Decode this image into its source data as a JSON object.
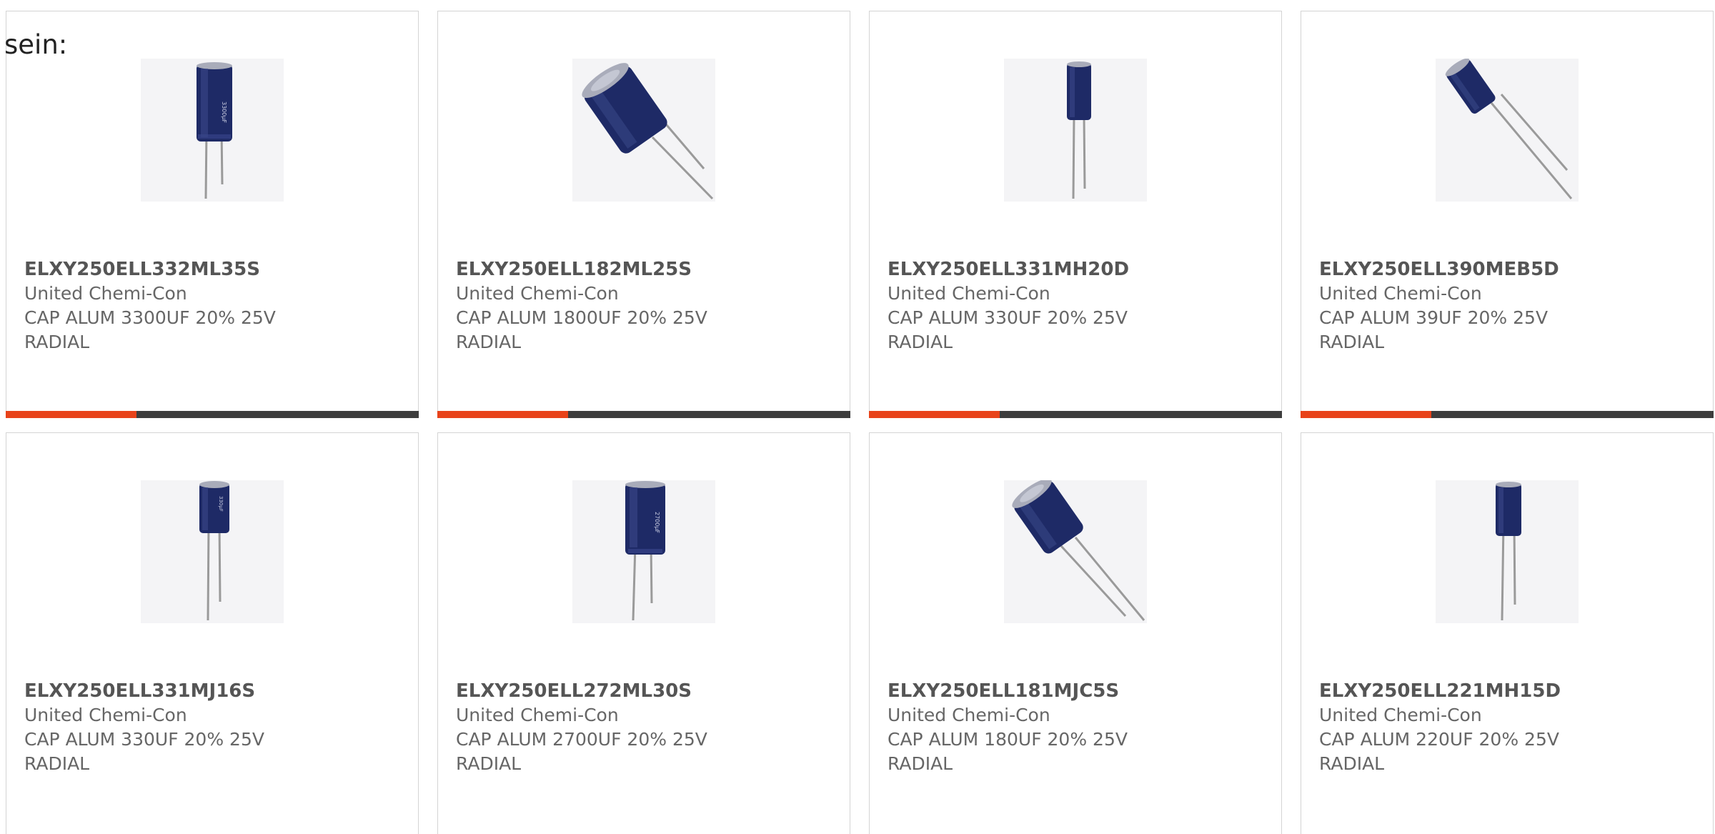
{
  "intro_text": "sein:",
  "colors": {
    "accent": "#e8431a",
    "bar": "#3d3d3d",
    "border": "#d4d4d4",
    "capacitor_body": "#1e2a66",
    "capacitor_top": "#a9acba",
    "lead": "#9a9a9a"
  },
  "products": [
    {
      "part_number": "ELXY250ELL332ML35S",
      "manufacturer": "United Chemi-Con",
      "desc_line1": "CAP ALUM 3300UF 20% 25V",
      "desc_line2": "RADIAL",
      "image": "capacitor-upright"
    },
    {
      "part_number": "ELXY250ELL182ML25S",
      "manufacturer": "United Chemi-Con",
      "desc_line1": "CAP ALUM 1800UF 20% 25V",
      "desc_line2": "RADIAL",
      "image": "capacitor-tilted"
    },
    {
      "part_number": "ELXY250ELL331MH20D",
      "manufacturer": "United Chemi-Con",
      "desc_line1": "CAP ALUM 330UF 20% 25V",
      "desc_line2": "RADIAL",
      "image": "capacitor-upright"
    },
    {
      "part_number": "ELXY250ELL390MEB5D",
      "manufacturer": "United Chemi-Con",
      "desc_line1": "CAP ALUM 39UF 20% 25V",
      "desc_line2": "RADIAL",
      "image": "capacitor-tilted"
    },
    {
      "part_number": "ELXY250ELL331MJ16S",
      "manufacturer": "United Chemi-Con",
      "desc_line1": "CAP ALUM 330UF 20% 25V",
      "desc_line2": "RADIAL",
      "image": "capacitor-upright"
    },
    {
      "part_number": "ELXY250ELL272ML30S",
      "manufacturer": "United Chemi-Con",
      "desc_line1": "CAP ALUM 2700UF 20% 25V",
      "desc_line2": "RADIAL",
      "image": "capacitor-upright"
    },
    {
      "part_number": "ELXY250ELL181MJC5S",
      "manufacturer": "United Chemi-Con",
      "desc_line1": "CAP ALUM 180UF 20% 25V",
      "desc_line2": "RADIAL",
      "image": "capacitor-tilted"
    },
    {
      "part_number": "ELXY250ELL221MH15D",
      "manufacturer": "United Chemi-Con",
      "desc_line1": "CAP ALUM 220UF 20% 25V",
      "desc_line2": "RADIAL",
      "image": "capacitor-upright"
    }
  ]
}
